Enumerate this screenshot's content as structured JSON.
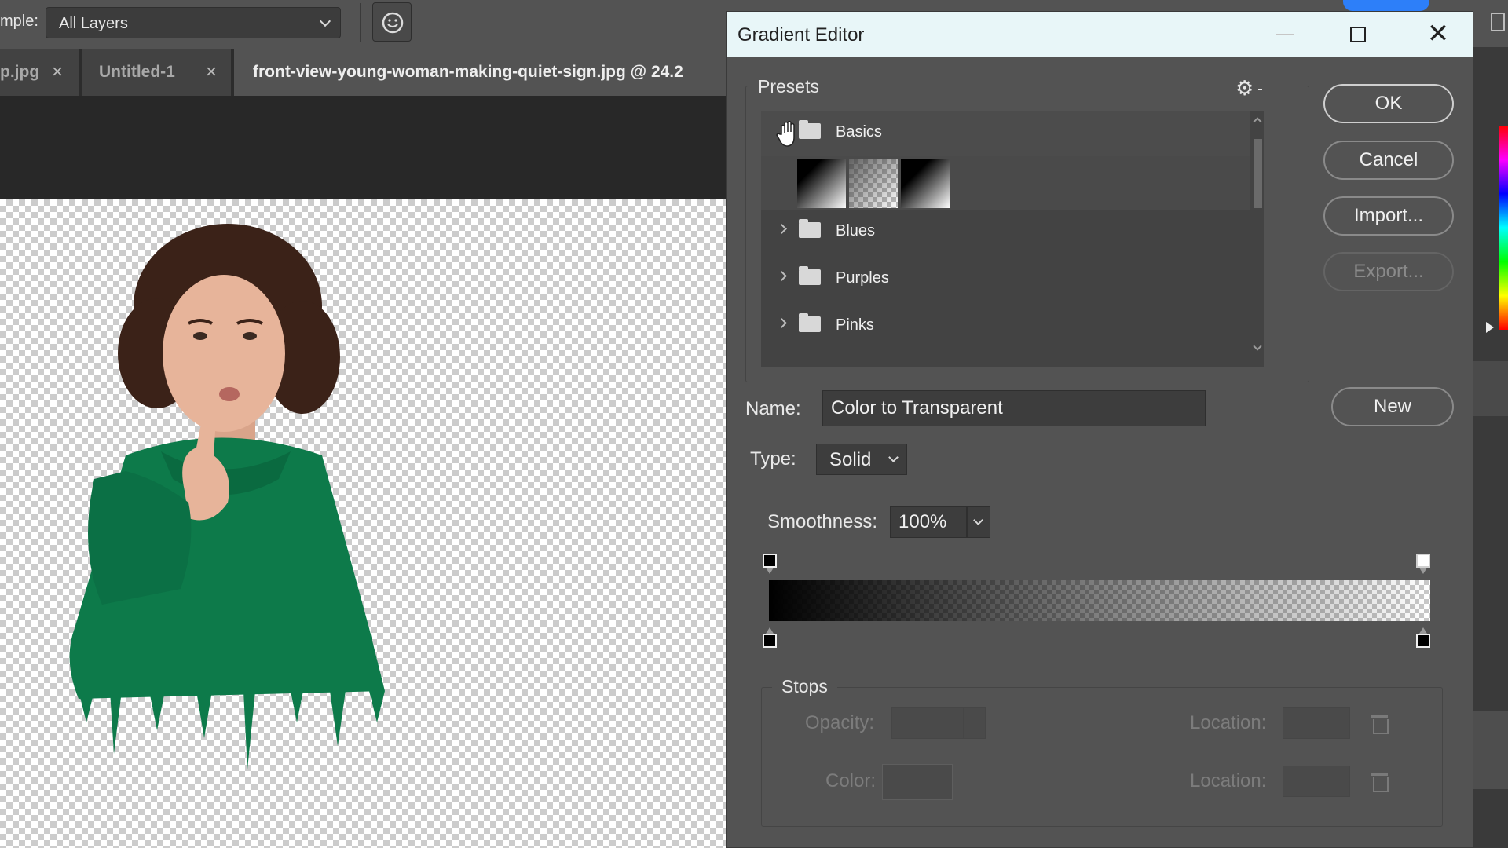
{
  "options_bar": {
    "sample_label": "mple:",
    "layers_value": "All Layers"
  },
  "tabs": [
    {
      "label": "p.jpg",
      "close": "×"
    },
    {
      "label": "Untitled-1",
      "close": "×"
    },
    {
      "label": "front-view-young-woman-making-quiet-sign.jpg @ 24.2"
    }
  ],
  "dialog": {
    "title": "Gradient Editor",
    "close": "✕",
    "presets_label": "Presets",
    "folders": [
      {
        "name": "Basics"
      },
      {
        "name": "Blues"
      },
      {
        "name": "Purples"
      },
      {
        "name": "Pinks"
      }
    ],
    "buttons": {
      "ok": "OK",
      "cancel": "Cancel",
      "import": "Import...",
      "export": "Export...",
      "new": "New"
    },
    "name_label": "Name:",
    "name_value": "Color to Transparent",
    "type_label": "Type:",
    "type_value": "Solid",
    "smoothness_label": "Smoothness:",
    "smoothness_value": "100%",
    "stops_label": "Stops",
    "opacity_label": "Opacity:",
    "color_label": "Color:",
    "location_label": "Location:"
  },
  "colors": {
    "hoodie": "#0d7a4a",
    "accent_blue": "#2d7ff9"
  }
}
